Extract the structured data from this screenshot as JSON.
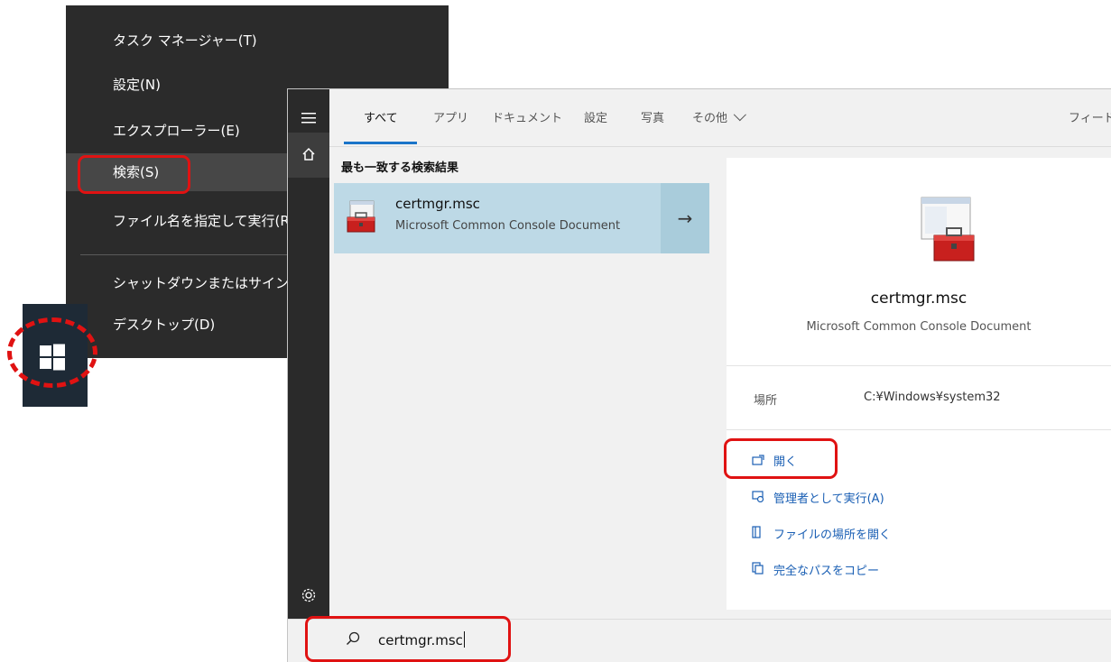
{
  "context_menu": {
    "items": [
      {
        "label": "タスク マネージャー(T)"
      },
      {
        "label": "設定(N)"
      },
      {
        "label": "エクスプローラー(E)"
      },
      {
        "label": "検索(S)"
      },
      {
        "label": "ファイル名を指定して実行(R)"
      },
      {
        "label": "シャットダウンまたはサインアウト(U)"
      },
      {
        "label": "デスクトップ(D)"
      }
    ]
  },
  "search": {
    "tabs": [
      {
        "label": "すべて"
      },
      {
        "label": "アプリ"
      },
      {
        "label": "ドキュメント"
      },
      {
        "label": "設定"
      },
      {
        "label": "写真"
      },
      {
        "label": "その他"
      }
    ],
    "feedback_label": "フィードバック",
    "best_match_title": "最も一致する検索結果",
    "result": {
      "name": "certmgr.msc",
      "type": "Microsoft Common Console Document"
    },
    "detail": {
      "name": "certmgr.msc",
      "type": "Microsoft Common Console Document",
      "location_label": "場所",
      "location_value": "C:¥Windows¥system32",
      "actions": [
        {
          "label": "開く",
          "icon": "open-icon"
        },
        {
          "label": "管理者として実行(A)",
          "icon": "shield-admin-icon"
        },
        {
          "label": "ファイルの場所を開く",
          "icon": "folder-location-icon"
        },
        {
          "label": "完全なパスをコピー",
          "icon": "copy-icon"
        }
      ]
    },
    "query": "certmgr.msc"
  },
  "colors": {
    "menu_bg": "#2b2b2b",
    "highlight_red": "#e01212",
    "selected_result": "#bdd9e6",
    "accent_blue": "#1a74c9"
  }
}
